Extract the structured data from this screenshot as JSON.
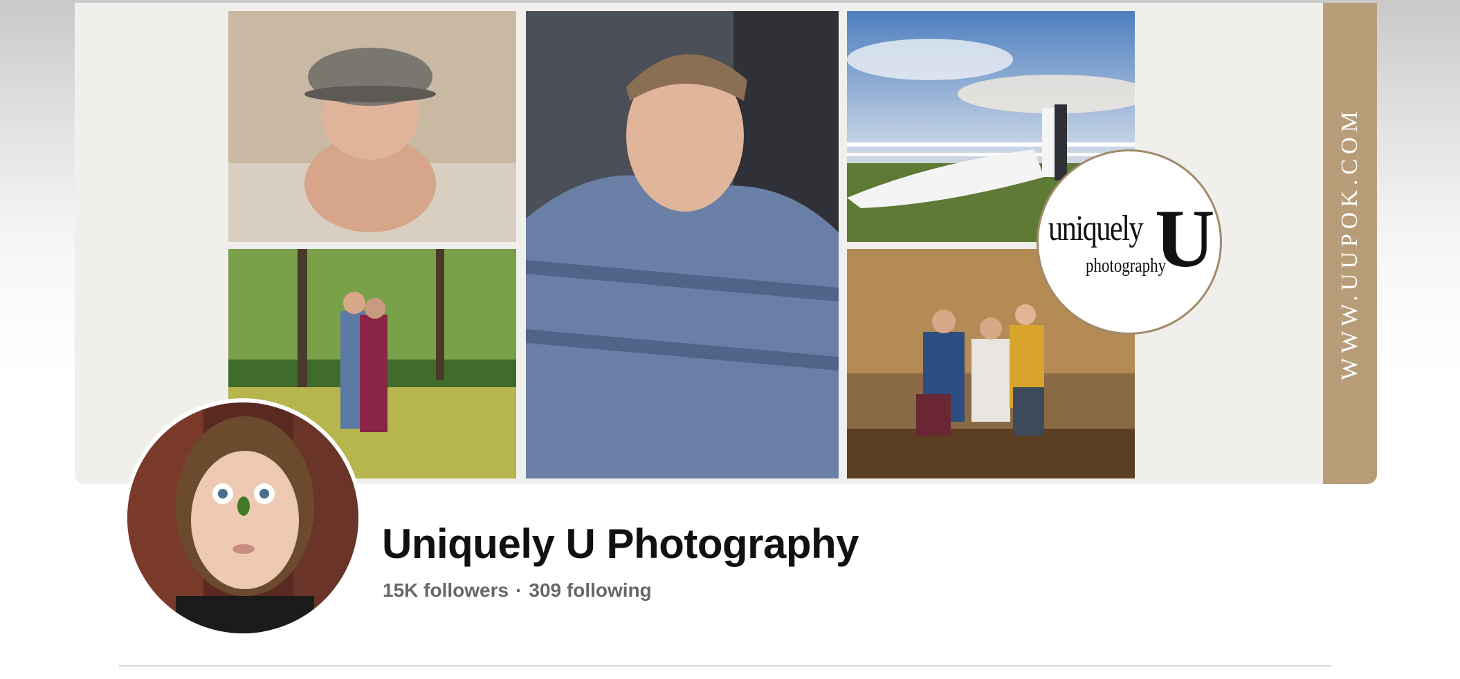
{
  "cover": {
    "website": "WWW.UUPOK.COM",
    "logo": {
      "word": "uniquely",
      "letter": "U",
      "tagline": "photography"
    },
    "photos": [
      "newborn-photo",
      "senior-portrait-photo",
      "maternity-photo",
      "wedding-photo",
      "family-photo"
    ]
  },
  "profile": {
    "name": "Uniquely U Photography",
    "followers": "15K followers",
    "separator": "·",
    "following": "309 following"
  },
  "colors": {
    "cover_bg": "#f1efec",
    "strip": "#b69b76",
    "title": "#111111",
    "stats": "#65676b"
  }
}
